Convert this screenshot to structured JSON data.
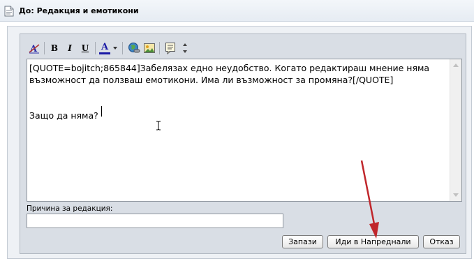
{
  "window": {
    "title": "До: Редакция и емотикони"
  },
  "toolbar": {
    "items": [
      "remove-format-icon",
      "bold-icon",
      "italic-icon",
      "underline-icon",
      "font-color-icon",
      "link-icon",
      "image-icon",
      "quote-icon",
      "resize-icon"
    ],
    "bold_label": "B",
    "italic_label": "I",
    "underline_label": "U",
    "font_color_label": "A",
    "font_color": "#1a1aa6"
  },
  "editor": {
    "content": "[QUOTE=bojitch;865844]Забелязах едно неудобство. Когато редактираш мнение няма възможност да ползваш емотикони. Има ли възможност за промяна?[/QUOTE]\n\n\nЗащо да няма?"
  },
  "reason": {
    "label": "Причина за редакция:",
    "value": ""
  },
  "buttons": {
    "save": "Запази",
    "advanced": "Иди в Напреднали",
    "cancel": "Отказ"
  },
  "annotation": {
    "arrow_color": "#c0262b"
  }
}
